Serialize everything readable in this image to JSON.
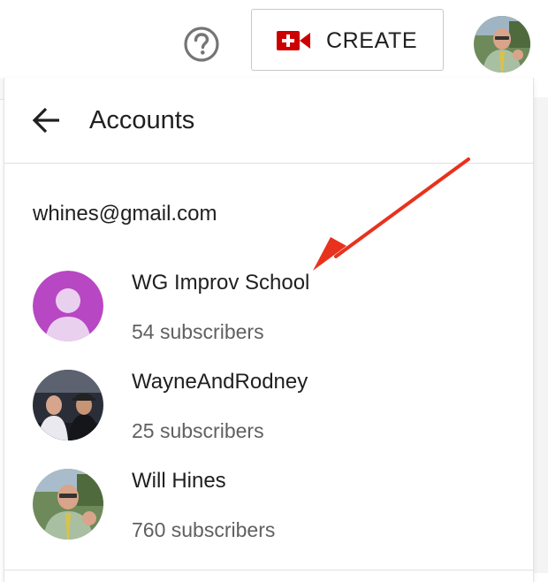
{
  "topbar": {
    "help_icon": "help-circle-icon",
    "create_button": {
      "label": "CREATE",
      "icon": "video-camera-plus-icon",
      "icon_color": "#cc0000"
    },
    "avatar": "user-avatar-icon"
  },
  "accounts_panel": {
    "title": "Accounts",
    "back_icon": "arrow-back-icon",
    "email": "whines@gmail.com",
    "accounts": [
      {
        "name": "WG Improv School",
        "subscribers": "54 subscribers",
        "avatar_color": "#b847c4"
      },
      {
        "name": "WayneAndRodney",
        "subscribers": "25 subscribers"
      },
      {
        "name": "Will Hines",
        "subscribers": "760 subscribers"
      }
    ]
  },
  "annotation": {
    "arrow_color": "#e8321e",
    "target": "WG Improv School"
  }
}
